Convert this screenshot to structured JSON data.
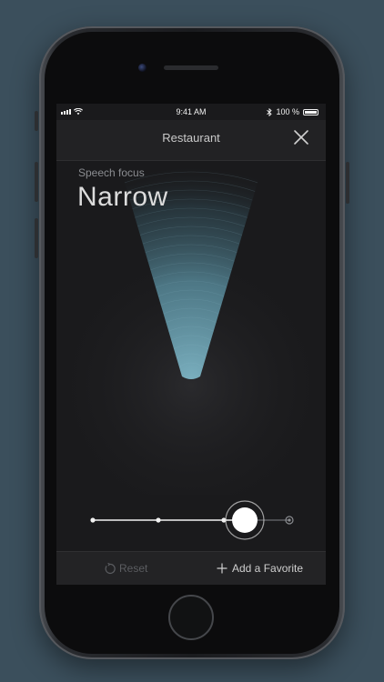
{
  "status_bar": {
    "time": "9:41 AM",
    "battery": "100 %"
  },
  "nav": {
    "title": "Restaurant",
    "close_icon": "close-icon"
  },
  "speech_focus": {
    "label": "Speech focus",
    "value": "Narrow"
  },
  "slider": {
    "stops": 4,
    "selected_stop": 3
  },
  "bottom_bar": {
    "reset_label": "Reset",
    "reset_icon": "reset-icon",
    "favorite_label": "Add a Favorite",
    "favorite_icon": "plus-icon"
  },
  "colors": {
    "accent_beam": "#5e96a8",
    "background": "#3b4f5c"
  }
}
